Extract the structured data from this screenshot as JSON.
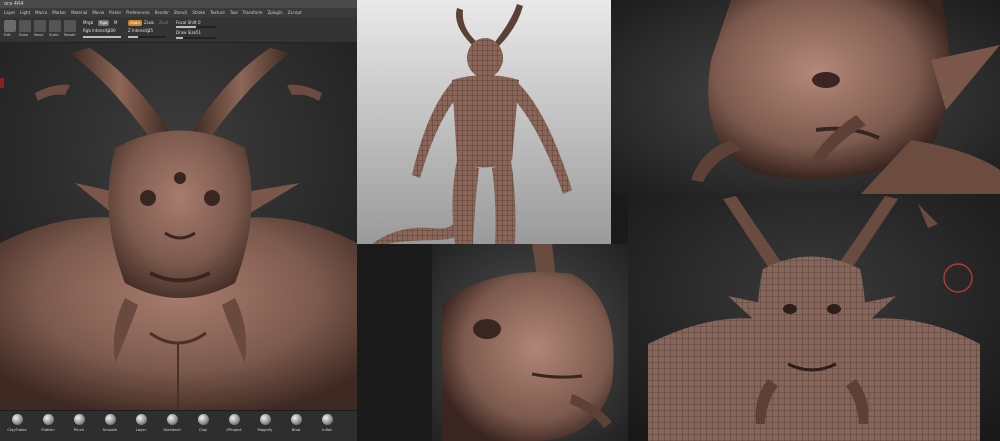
{
  "window": {
    "title": "ora 4R4"
  },
  "menu": [
    "Layer",
    "Light",
    "Macro",
    "Marker",
    "Material",
    "Movie",
    "Picker",
    "Preferences",
    "Render",
    "Stencil",
    "Stroke",
    "Texture",
    "Tool",
    "Transform",
    "Zplugin",
    "Zscript"
  ],
  "toolbar": {
    "buttons": [
      "Edit",
      "Draw",
      "Move",
      "Scale",
      "Rotate"
    ],
    "mrgb_label": "Mrgb",
    "rgb_label": "Rgb",
    "m_label": "M",
    "zadd_label": "Zadd",
    "zsub_label": "Zsub",
    "zcut_label": "Zcut",
    "focal_shift_label": "Focal Shift",
    "focal_shift_value": "0",
    "draw_size_label": "Draw Size",
    "draw_size_value": "51",
    "rgb_intensity_label": "Rgb Intensity",
    "rgb_intensity_value": "100",
    "z_intensity_label": "Z Intensity",
    "z_intensity_value": "25",
    "focal_shift_fraction": 0.5,
    "draw_size_fraction": 0.18,
    "rgb_intensity_fraction": 1.0,
    "z_intensity_fraction": 0.25
  },
  "brushes": [
    "ClayTubes",
    "Flatten",
    "Pinch",
    "Smooth",
    "Layer",
    "Standard",
    "Clay",
    "ZProject",
    "Magnify",
    "Blob",
    "Inflat"
  ],
  "colors": {
    "skin": "#7d5a4e",
    "skin_light": "#a5786a",
    "skin_dark": "#3a2620",
    "bg_dark": "#1e1e1e",
    "accent_orange": "#c8862e",
    "cursor_red": "#b33a3a"
  }
}
